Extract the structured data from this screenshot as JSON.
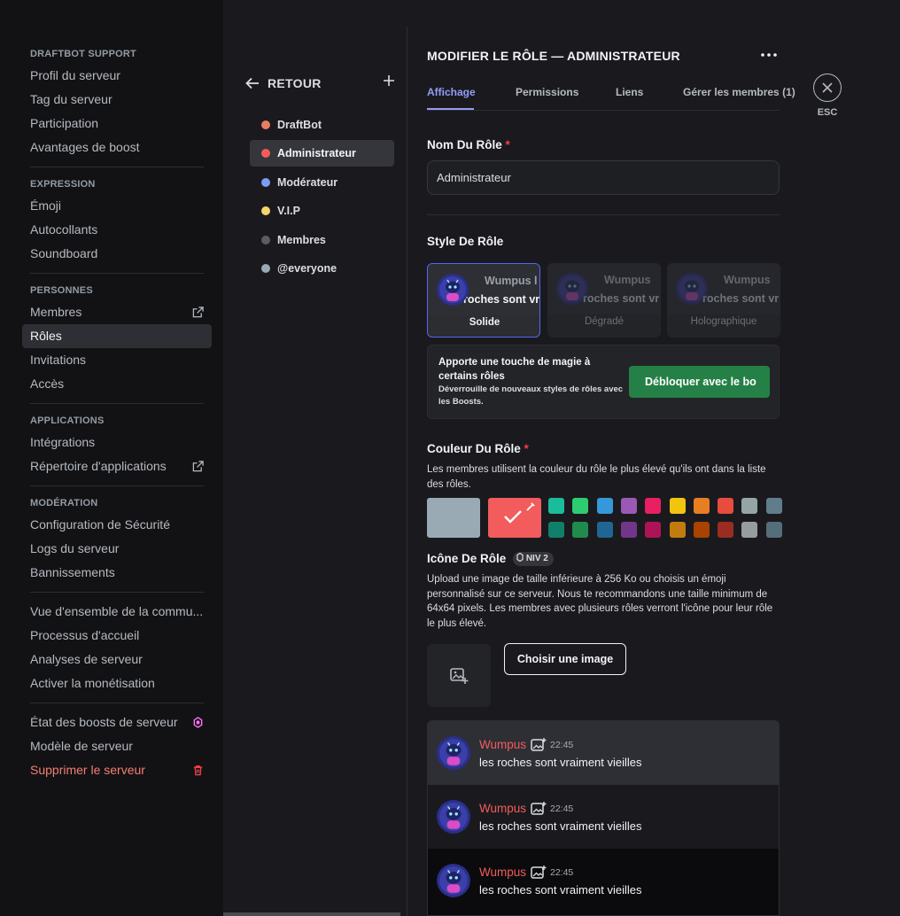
{
  "sidebar": {
    "sections": [
      {
        "header": "DRAFTBOT SUPPORT",
        "items": [
          "Profil du serveur",
          "Tag du serveur",
          "Participation",
          "Avantages de boost"
        ]
      },
      {
        "header": "EXPRESSION",
        "items": [
          "Émoji",
          "Autocollants",
          "Soundboard"
        ]
      },
      {
        "header": "PERSONNES",
        "items": [
          "Membres",
          "Rôles",
          "Invitations",
          "Accès"
        ]
      },
      {
        "header": "APPLICATIONS",
        "items": [
          "Intégrations",
          "Répertoire d'applications"
        ]
      },
      {
        "header": "MODÉRATION",
        "items": [
          "Configuration de Sécurité",
          "Logs du serveur",
          "Bannissements"
        ]
      },
      {
        "header": "",
        "items": [
          "Vue d'ensemble de la commu...",
          "Processus d'accueil",
          "Analyses de serveur",
          "Activer la monétisation"
        ]
      },
      {
        "header": "",
        "items": [
          "État des boosts de serveur",
          "Modèle de serveur",
          "Supprimer le serveur"
        ]
      }
    ],
    "active_item": "Rôles"
  },
  "roles_panel": {
    "back_label": "RETOUR",
    "roles": [
      {
        "name": "DraftBot",
        "color": "#e67e5f"
      },
      {
        "name": "Administrateur",
        "color": "#f25c5c"
      },
      {
        "name": "Modérateur",
        "color": "#7c9cf5"
      },
      {
        "name": "V.I.P",
        "color": "#f5d56b"
      },
      {
        "name": "Membres",
        "color": "#5c5d63"
      },
      {
        "name": "@everyone",
        "color": "#99aab5"
      }
    ],
    "active_role": "Administrateur"
  },
  "editor": {
    "title": "MODIFIER LE RÔLE — ADMINISTRATEUR",
    "tabs": [
      "Affichage",
      "Permissions",
      "Liens",
      "Gérer les membres (1)"
    ],
    "active_tab": "Affichage",
    "name_label": "Nom Du Rôle",
    "required_mark": "*",
    "name_value": "Administrateur",
    "style_label": "Style De Rôle",
    "style_options": [
      {
        "caption": "Solide",
        "preview_name": "Wumpus l",
        "preview_msg": "roches sont vr"
      },
      {
        "caption": "Dégradé",
        "preview_name": "Wumpus",
        "preview_msg": "roches sont vr"
      },
      {
        "caption": "Holographique",
        "preview_name": "Wumpus",
        "preview_msg": "roches sont vr"
      }
    ],
    "boost_title": "Apporte une touche de magie à certains rôles",
    "boost_sub": "Déverrouille de nouveaux styles de rôles avec les Boosts.",
    "boost_button": "Débloquer avec le bo",
    "color_label": "Couleur Du Rôle",
    "color_desc": "Les membres utilisent la couleur du rôle le plus élevé qu'ils ont dans la liste des rôles.",
    "default_color": "#99aab5",
    "custom_color": "#f25c5c",
    "palette_row1": [
      "#1abc9c",
      "#2ecc71",
      "#3498db",
      "#9b59b6",
      "#e91e63",
      "#f1c40f",
      "#e67e22",
      "#e74c3c",
      "#95a5a6",
      "#607d8b"
    ],
    "palette_row2": [
      "#11806a",
      "#1f8b4c",
      "#206694",
      "#71368a",
      "#ad1457",
      "#c27c0e",
      "#a84300",
      "#992d22",
      "#979c9f",
      "#546e7a"
    ],
    "icon_label": "Icône De Rôle",
    "icon_badge": "NIV 2",
    "icon_desc": "Upload une image de taille inférieure à 256 Ko ou choisis un émoji personnalisé sur ce serveur. Nous te recommandons une taille minimum de 64x64 pixels. Les membres avec plusieurs rôles verront l'icône pour leur rôle le plus élevé.",
    "choose_image": "Choisir une image",
    "close_label": "ESC"
  },
  "chat_preview": [
    {
      "name": "Wumpus",
      "time": "22:45",
      "message": "les roches sont vraiment vieilles",
      "bg": "#2e2f35"
    },
    {
      "name": "Wumpus",
      "time": "22:45",
      "message": "les roches sont vraiment vieilles",
      "bg": "#1a1a1e"
    },
    {
      "name": "Wumpus",
      "time": "22:45",
      "message": "les roches sont vraiment vieilles",
      "bg": "#0b0b0d"
    }
  ],
  "colors": {
    "accent": "#5865f2",
    "tab_active": "#949cf7",
    "boost_green": "#248046",
    "danger": "#f57e71"
  }
}
